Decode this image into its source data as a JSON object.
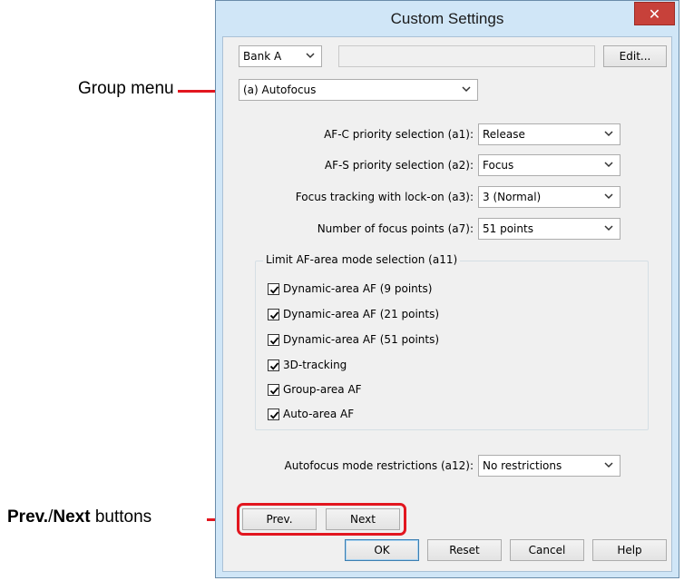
{
  "callouts": {
    "group_menu": "Group menu",
    "prev_next_bold1": "Prev.",
    "prev_next_sep": "/",
    "prev_next_bold2": "Next",
    "prev_next_rest": " buttons",
    "accent_color": "#e2161f"
  },
  "window": {
    "title": "Custom Settings",
    "close_glyph": "✕"
  },
  "bank": {
    "selected": "Bank A",
    "name_value": "",
    "edit_label": "Edit..."
  },
  "group_menu": {
    "selected": "(a) Autofocus"
  },
  "settings": [
    {
      "label": "AF-C priority selection (a1):",
      "value": "Release"
    },
    {
      "label": "AF-S priority selection (a2):",
      "value": "Focus"
    },
    {
      "label": "Focus tracking with lock-on (a3):",
      "value": "3 (Normal)"
    },
    {
      "label": "Number of focus points (a7):",
      "value": "51 points"
    }
  ],
  "af_area": {
    "title": "Limit AF-area mode selection (a11)",
    "items": [
      {
        "label": "Dynamic-area AF (9 points)",
        "checked": true
      },
      {
        "label": "Dynamic-area AF (21 points)",
        "checked": true
      },
      {
        "label": "Dynamic-area AF (51 points)",
        "checked": true
      },
      {
        "label": "3D-tracking",
        "checked": true
      },
      {
        "label": "Group-area AF",
        "checked": true
      },
      {
        "label": "Auto-area AF",
        "checked": true
      }
    ]
  },
  "restrictions": {
    "label": "Autofocus mode restrictions (a12):",
    "value": "No restrictions"
  },
  "nav": {
    "prev_label": "Prev.",
    "next_label": "Next"
  },
  "footer": {
    "ok_label": "OK",
    "reset_label": "Reset",
    "cancel_label": "Cancel",
    "help_label": "Help"
  }
}
